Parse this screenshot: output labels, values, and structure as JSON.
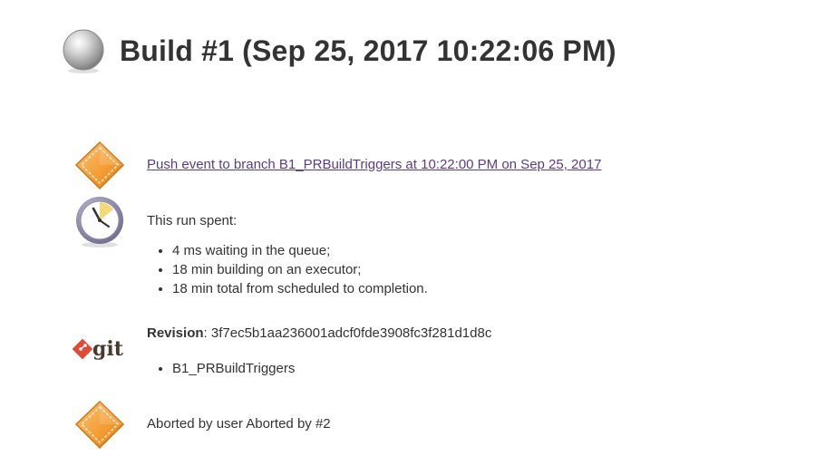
{
  "build": {
    "title": "Build #1 (Sep 25, 2017 10:22:06 PM)",
    "status_icon": "grey-ball-icon"
  },
  "cause": {
    "icon": "orange-diamond-icon",
    "link_text": "Push event to branch B1_PRBuildTriggers at 10:22:00 PM on Sep 25, 2017"
  },
  "timing": {
    "icon": "clock-icon",
    "heading": "This run spent:",
    "items": [
      "4 ms waiting in the queue;",
      "18 min building on an executor;",
      "18 min total from scheduled to completion."
    ]
  },
  "revision": {
    "icon": "git-logo-icon",
    "logo_text": "git",
    "label": "Revision",
    "separator": ":",
    "hash": "3f7ec5b1aa236001adcf0fde3908fc3f281d1d8c",
    "branches": [
      "B1_PRBuildTriggers"
    ]
  },
  "aborted": {
    "icon": "orange-diamond-icon",
    "text": "Aborted by user Aborted by #2"
  },
  "colors": {
    "title": "#333333",
    "link": "#5a3c82",
    "diamond": "#f39c32",
    "git_red": "#de4c36"
  }
}
